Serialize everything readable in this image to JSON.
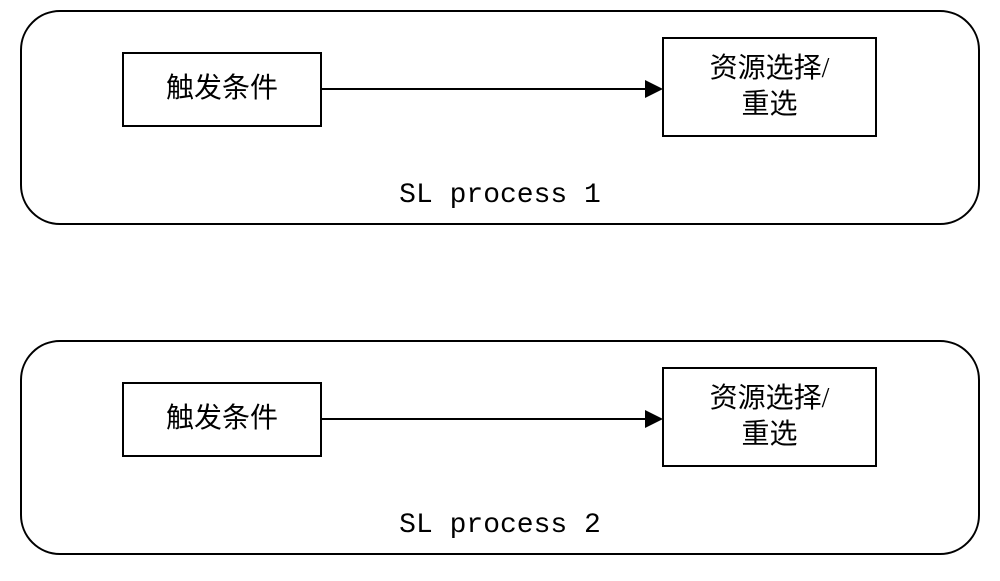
{
  "processes": [
    {
      "label": "SL process 1",
      "trigger_text": "触发条件",
      "resource_text": "资源选择/\n重选"
    },
    {
      "label": "SL process 2",
      "trigger_text": "触发条件",
      "resource_text": "资源选择/\n重选"
    }
  ]
}
